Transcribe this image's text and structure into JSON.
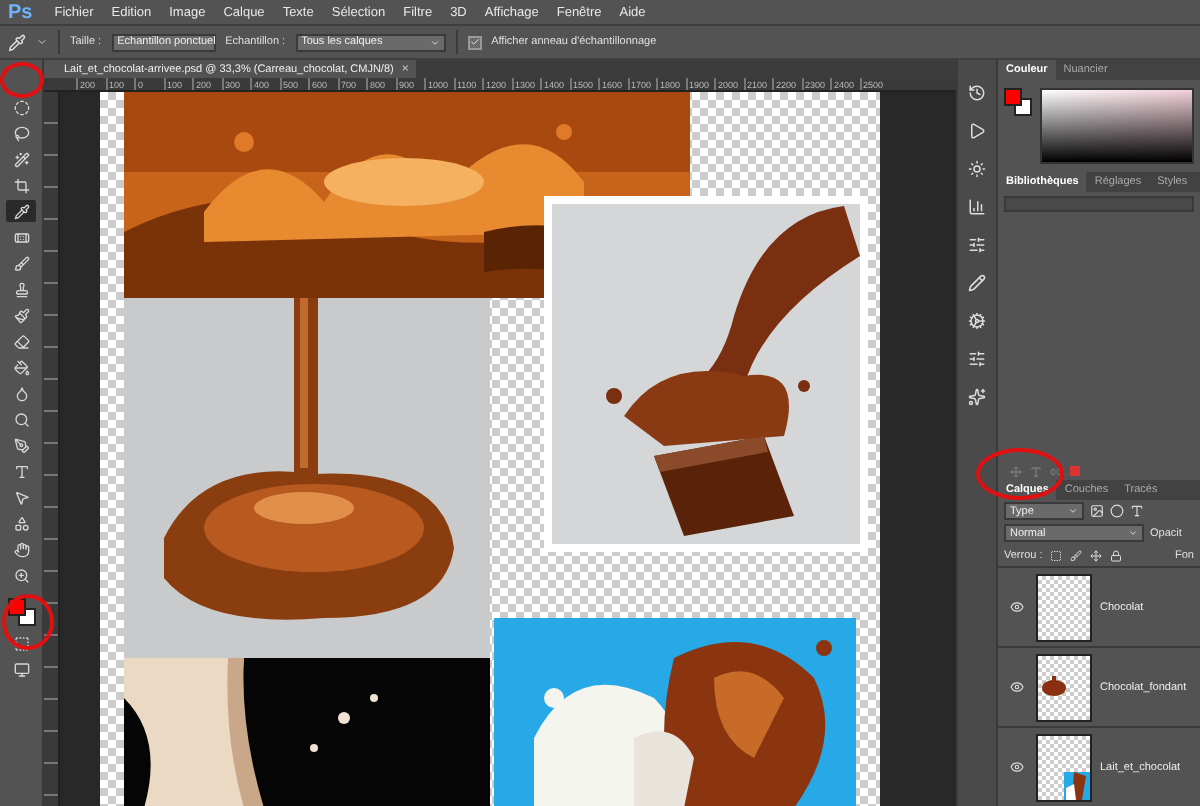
{
  "app": {
    "logo": "Ps"
  },
  "menu": [
    "Fichier",
    "Edition",
    "Image",
    "Calque",
    "Texte",
    "Sélection",
    "Filtre",
    "3D",
    "Affichage",
    "Fenêtre",
    "Aide"
  ],
  "options": {
    "size_label": "Taille :",
    "size_value": "Echantillon ponctuel",
    "sample_label": "Echantillon :",
    "sample_value": "Tous les calques",
    "ring": {
      "label": "Afficher anneau d'échantillonnage",
      "checked": true
    }
  },
  "document_tab": {
    "title": "Lait_et_chocolat-arrivee.psd @ 33,3% (Carreau_chocolat, CMJN/8)",
    "close": "×"
  },
  "ruler": [
    "200",
    "100",
    "0",
    "100",
    "200",
    "300",
    "400",
    "500",
    "600",
    "700",
    "800",
    "900",
    "1000",
    "1100",
    "1200",
    "1300",
    "1400",
    "1500",
    "1600",
    "1700",
    "1800",
    "1900",
    "2000",
    "2100",
    "2200",
    "2300",
    "2400",
    "2500"
  ],
  "tools": [
    {
      "selected": false
    },
    {
      "selected": false
    },
    {
      "selected": false
    },
    {
      "selected": false
    },
    {
      "selected": true
    },
    {
      "selected": false
    },
    {
      "selected": false
    },
    {
      "selected": false
    },
    {
      "selected": false
    },
    {
      "selected": false
    },
    {
      "selected": false
    },
    {
      "selected": false
    },
    {
      "selected": false
    },
    {
      "selected": false
    },
    {
      "selected": false
    },
    {
      "selected": false
    },
    {
      "selected": false
    },
    {
      "selected": false
    },
    {
      "selected": false
    }
  ],
  "color_panel": {
    "tabs": [
      {
        "label": "Couleur",
        "selected": true
      },
      {
        "label": "Nuancier",
        "selected": false
      }
    ]
  },
  "library_panel": {
    "tabs": [
      {
        "label": "Bibliothèques",
        "selected": true
      },
      {
        "label": "Réglages",
        "selected": false
      },
      {
        "label": "Styles",
        "selected": false
      }
    ]
  },
  "layers_panel": {
    "tabs": [
      {
        "label": "Calques",
        "selected": true
      },
      {
        "label": "Couches",
        "selected": false
      },
      {
        "label": "Tracés",
        "selected": false
      }
    ],
    "filter": "Type",
    "blend_mode": "Normal",
    "opacity_label": "Opacit",
    "lock_label": "Verrou :",
    "fill_label": "Fon",
    "layers": [
      {
        "name": "Chocolat",
        "visible": true
      },
      {
        "name": "Chocolat_fondant",
        "visible": true
      },
      {
        "name": "Lait_et_chocolat",
        "visible": true
      }
    ]
  }
}
